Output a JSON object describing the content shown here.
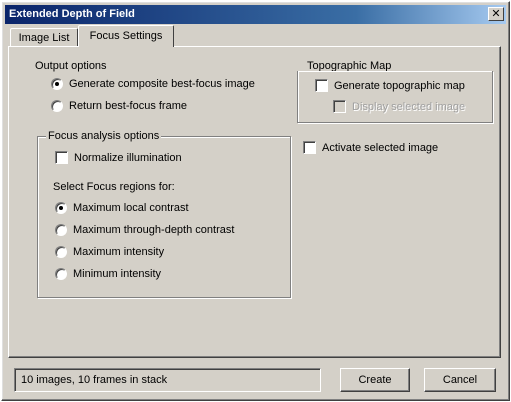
{
  "window": {
    "title": "Extended Depth of Field",
    "close_glyph": "✕"
  },
  "tabs": [
    {
      "label": "Image List",
      "active": false
    },
    {
      "label": "Focus Settings",
      "active": true
    }
  ],
  "output_options": {
    "label": "Output options",
    "options": [
      {
        "label": "Generate composite best-focus image",
        "selected": true
      },
      {
        "label": "Return best-focus frame",
        "selected": false
      }
    ]
  },
  "focus_analysis": {
    "label": "Focus analysis options",
    "normalize_label": "Normalize illumination",
    "normalize_checked": false,
    "regions_label": "Select Focus regions for:",
    "options": [
      {
        "label": "Maximum local contrast",
        "selected": true
      },
      {
        "label": "Maximum through-depth contrast",
        "selected": false
      },
      {
        "label": "Maximum intensity",
        "selected": false
      },
      {
        "label": "Minimum intensity",
        "selected": false
      }
    ]
  },
  "topographic_map": {
    "label": "Topographic Map",
    "generate_label": "Generate topographic map",
    "generate_checked": false,
    "sub_label": "Display selected image",
    "sub_checked": false
  },
  "activate_selected": {
    "label": "Activate selected image",
    "checked": false
  },
  "status": {
    "text": "10 images, 10 frames in stack"
  },
  "buttons": {
    "create": "Create",
    "cancel": "Cancel"
  }
}
